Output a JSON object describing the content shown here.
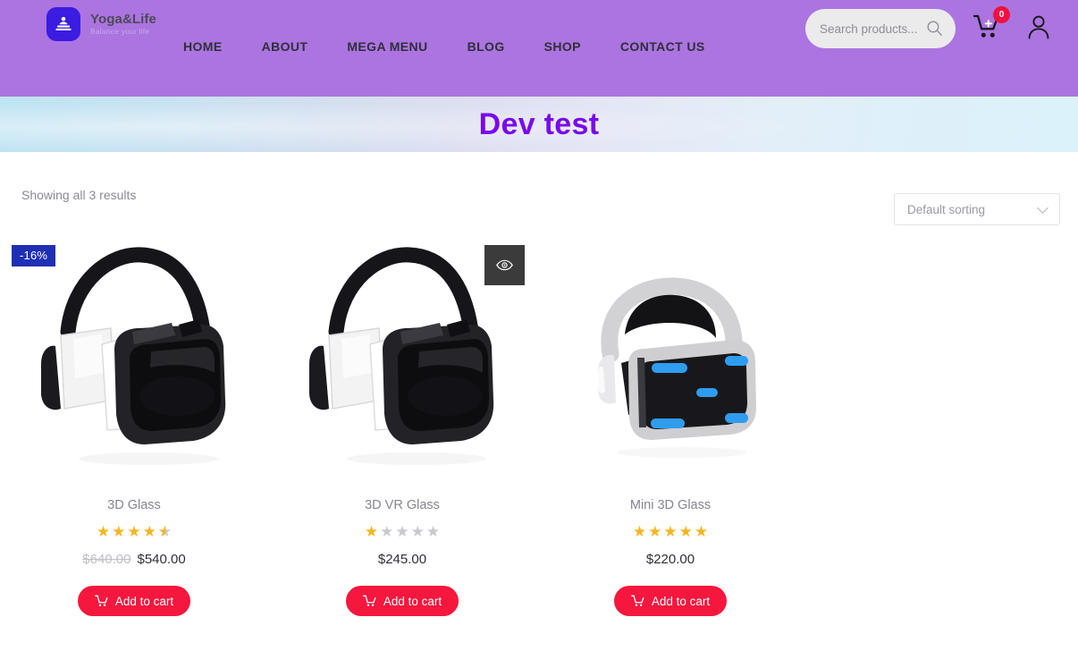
{
  "header": {
    "logo": {
      "title": "Yoga&Life",
      "tagline": "Balance your life",
      "icon": "meditation-icon",
      "bg_color": "#3b1ce0"
    },
    "bg_color": "#ab74e0",
    "nav": [
      {
        "label": "HOME"
      },
      {
        "label": "ABOUT"
      },
      {
        "label": "MEGA MENU"
      },
      {
        "label": "BLOG"
      },
      {
        "label": "SHOP"
      },
      {
        "label": "CONTACT US"
      }
    ],
    "search": {
      "placeholder": "Search products...",
      "value": "",
      "icon": "search-icon"
    },
    "cart": {
      "icon": "cart-plus-icon",
      "count": "0",
      "badge_color": "#f2113e"
    },
    "account": {
      "icon": "user-icon"
    }
  },
  "banner": {
    "title": "Dev test",
    "title_color": "#7a08ee"
  },
  "toolbar": {
    "results_text": "Showing all 3 results",
    "sorting": {
      "selected": "Default sorting",
      "icon": "chevron-down-icon"
    }
  },
  "products": [
    {
      "title": "3D Glass",
      "badge": "-16%",
      "badge_color": "#1f2fb5",
      "rating": 4.5,
      "price_old": "$640.00",
      "price_now": "$540.00",
      "add_to_cart": "Add to cart",
      "image": "vr-headset-black-white"
    },
    {
      "title": "3D VR Glass",
      "badge": "",
      "rating": 1,
      "price_old": "",
      "price_now": "$245.00",
      "add_to_cart": "Add to cart",
      "quickview_icon": "eye-icon",
      "image": "vr-headset-black-white"
    },
    {
      "title": "Mini 3D Glass",
      "badge": "",
      "rating": 5,
      "price_old": "",
      "price_now": "$220.00",
      "add_to_cart": "Add to cart",
      "image": "vr-headset-psvr-blue"
    }
  ]
}
